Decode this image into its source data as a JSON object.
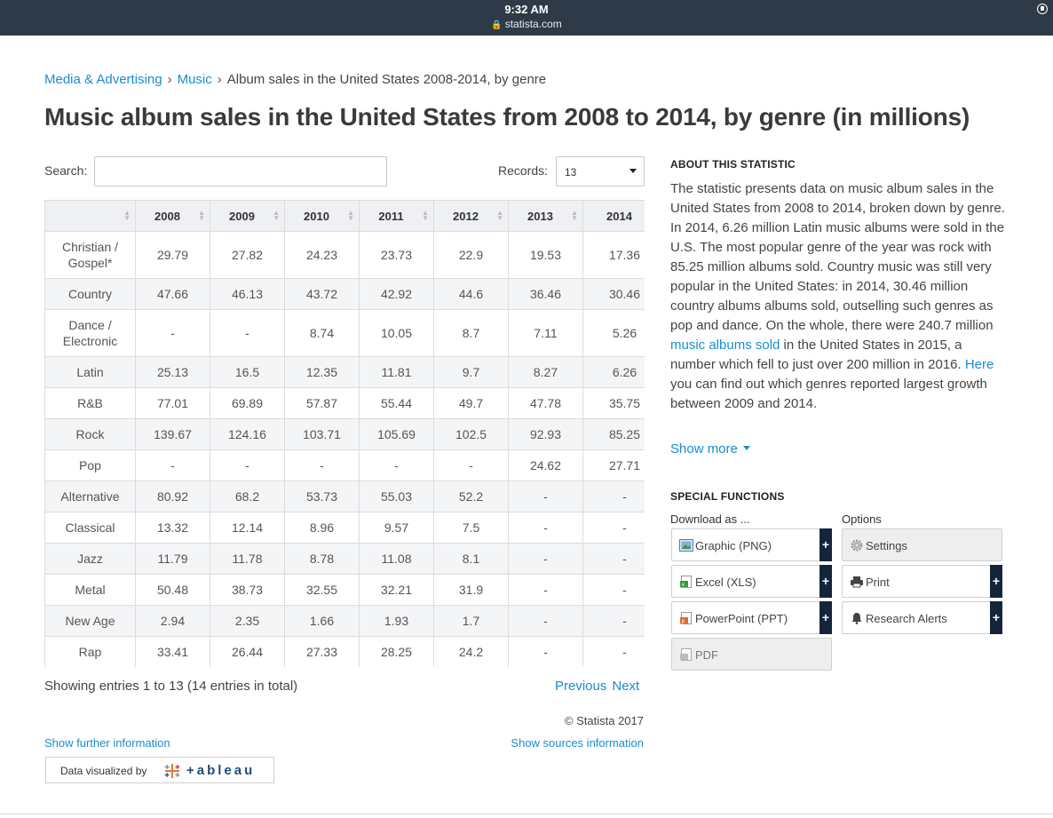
{
  "status_bar": {
    "time": "9:32 AM",
    "url": "statista.com"
  },
  "breadcrumb": {
    "items": [
      "Media & Advertising",
      "Music"
    ],
    "separator": "›",
    "current": "Album sales in the United States 2008-2014, by genre"
  },
  "title": "Music album sales in the United States from 2008 to 2014, by genre (in millions)",
  "controls": {
    "search_label": "Search:",
    "search_value": "",
    "records_label": "Records:",
    "records_value": "13"
  },
  "table": {
    "headers": [
      "",
      "2008",
      "2009",
      "2010",
      "2011",
      "2012",
      "2013",
      "2014"
    ],
    "rows": [
      [
        "Christian / Gospel*",
        "29.79",
        "27.82",
        "24.23",
        "23.73",
        "22.9",
        "19.53",
        "17.36"
      ],
      [
        "Country",
        "47.66",
        "46.13",
        "43.72",
        "42.92",
        "44.6",
        "36.46",
        "30.46"
      ],
      [
        "Dance / Electronic",
        "-",
        "-",
        "8.74",
        "10.05",
        "8.7",
        "7.11",
        "5.26"
      ],
      [
        "Latin",
        "25.13",
        "16.5",
        "12.35",
        "11.81",
        "9.7",
        "8.27",
        "6.26"
      ],
      [
        "R&B",
        "77.01",
        "69.89",
        "57.87",
        "55.44",
        "49.7",
        "47.78",
        "35.75"
      ],
      [
        "Rock",
        "139.67",
        "124.16",
        "103.71",
        "105.69",
        "102.5",
        "92.93",
        "85.25"
      ],
      [
        "Pop",
        "-",
        "-",
        "-",
        "-",
        "-",
        "24.62",
        "27.71"
      ],
      [
        "Alternative",
        "80.92",
        "68.2",
        "53.73",
        "55.03",
        "52.2",
        "-",
        "-"
      ],
      [
        "Classical",
        "13.32",
        "12.14",
        "8.96",
        "9.57",
        "7.5",
        "-",
        "-"
      ],
      [
        "Jazz",
        "11.79",
        "11.78",
        "8.78",
        "11.08",
        "8.1",
        "-",
        "-"
      ],
      [
        "Metal",
        "50.48",
        "38.73",
        "32.55",
        "32.21",
        "31.9",
        "-",
        "-"
      ],
      [
        "New Age",
        "2.94",
        "2.35",
        "1.66",
        "1.93",
        "1.7",
        "-",
        "-"
      ],
      [
        "Rap",
        "33.41",
        "26.44",
        "27.33",
        "28.25",
        "24.2",
        "-",
        "-"
      ]
    ]
  },
  "footer": {
    "entries": "Showing entries 1 to 13 (14 entries in total)",
    "previous": "Previous",
    "next": "Next",
    "copyright": "© Statista 2017",
    "further": "Show further information",
    "sources": "Show sources information",
    "tableau_text": "Data visualized by",
    "tableau_word": "+ableau"
  },
  "about": {
    "heading": "ABOUT THIS STATISTIC",
    "text_1": "The statistic presents data on music album sales in the United States from 2008 to 2014, broken down by genre. In 2014, 6.26 million Latin music albums were sold in the U.S. The most popular genre of the year was rock with 85.25 million albums sold. Country music was still very popular in the United States: in 2014, 30.46 million country albums albums sold, outselling such genres as pop and dance. On the whole, there were 240.7 million ",
    "link_1": "music albums sold",
    "text_2": " in the United States in 2015, a number which fell to just over 200 million in 2016. ",
    "link_2": "Here",
    "text_3": " you can find out which genres reported largest growth between 2009 and 2014.",
    "show_more": "Show more"
  },
  "special": {
    "heading": "SPECIAL FUNCTIONS",
    "download_label": "Download as ...",
    "options_label": "Options",
    "png": "Graphic (PNG)",
    "xls": "Excel (XLS)",
    "ppt": "PowerPoint (PPT)",
    "pdf": "PDF",
    "settings": "Settings",
    "print": "Print",
    "alerts": "Research Alerts",
    "plus": "+"
  },
  "colors": {
    "accent": "#1a8ccf",
    "status_bar": "#2e3a47",
    "button_dark": "#14253a"
  }
}
